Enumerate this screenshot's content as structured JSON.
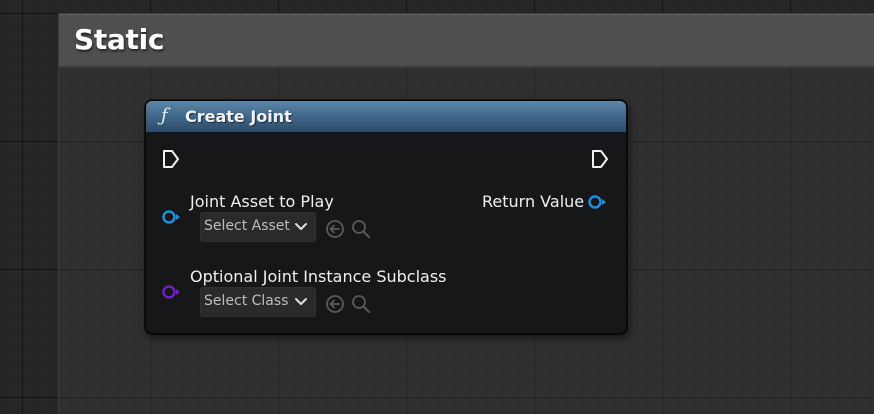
{
  "comment": {
    "title": "Static"
  },
  "node": {
    "title": "Create Joint",
    "header_color": "#426a8d",
    "title_icon": "function-icon",
    "inputs": [
      {
        "label": "Joint Asset to Play",
        "pin_color": "#1f8fde",
        "dropdown": "Select Asset",
        "dropdown_icon": "chevron-down-icon",
        "tools": [
          "use-selected-arrow-icon",
          "browse-search-icon"
        ]
      },
      {
        "label": "Optional Joint Instance Subclass",
        "pin_color": "#6d1fbf",
        "dropdown": "Select Class",
        "dropdown_icon": "chevron-down-icon",
        "tools": [
          "use-selected-arrow-icon",
          "browse-search-icon"
        ]
      }
    ],
    "outputs": [
      {
        "label": "Return Value",
        "pin_color": "#1f8fde"
      }
    ],
    "exec_pins": [
      "exec-in-pin-icon",
      "exec-out-pin-icon"
    ]
  }
}
